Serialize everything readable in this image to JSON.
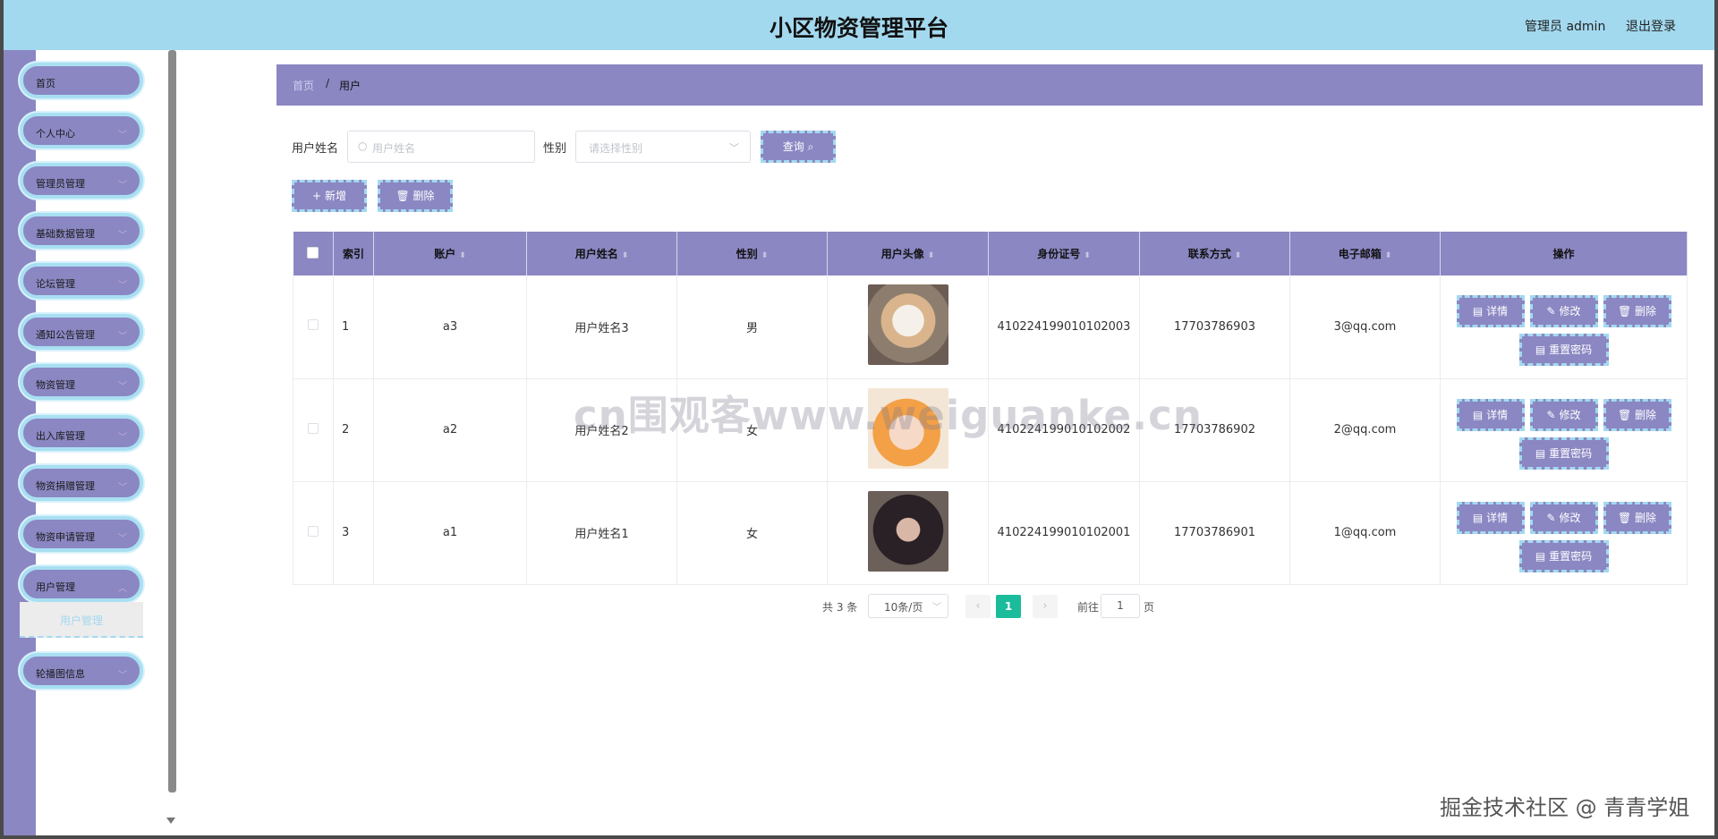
{
  "header": {
    "title": "小区物资管理平台",
    "admin": "管理员 admin",
    "logout": "退出登录"
  },
  "menu": [
    {
      "label": "首页",
      "chevron": false
    },
    {
      "label": "个人中心",
      "chevron": true
    },
    {
      "label": "管理员管理",
      "chevron": true
    },
    {
      "label": "基础数据管理",
      "chevron": true
    },
    {
      "label": "论坛管理",
      "chevron": true
    },
    {
      "label": "通知公告管理",
      "chevron": true
    },
    {
      "label": "物资管理",
      "chevron": true
    },
    {
      "label": "出入库管理",
      "chevron": true
    },
    {
      "label": "物资捐赠管理",
      "chevron": true
    },
    {
      "label": "物资申请管理",
      "chevron": true
    },
    {
      "label": "用户管理",
      "chevron": true
    },
    {
      "label": "轮播图信息",
      "chevron": true
    }
  ],
  "submenu": {
    "label": "用户管理"
  },
  "breadcrumb": {
    "home": "首页",
    "sep": "/",
    "current": "用户"
  },
  "search": {
    "name_label": "用户姓名",
    "name_placeholder": "用户姓名",
    "gender_label": "性别",
    "gender_placeholder": "请选择性别",
    "query": "查询"
  },
  "actions": {
    "add": "新增",
    "delete": "删除"
  },
  "table": {
    "columns": [
      "索引",
      "账户",
      "用户姓名",
      "性别",
      "用户头像",
      "身份证号",
      "联系方式",
      "电子邮箱",
      "操作"
    ],
    "rows": [
      {
        "index": "1",
        "account": "a3",
        "name": "用户姓名3",
        "gender": "男",
        "avatar": "shiba-dog-photo",
        "id": "410224199010102003",
        "phone": "17703786903",
        "email": "3@qq.com"
      },
      {
        "index": "2",
        "account": "a2",
        "name": "用户姓名2",
        "gender": "女",
        "avatar": "girl-photo",
        "id": "410224199010102002",
        "phone": "17703786902",
        "email": "2@qq.com"
      },
      {
        "index": "3",
        "account": "a1",
        "name": "用户姓名1",
        "gender": "女",
        "avatar": "boy-photo",
        "id": "410224199010102001",
        "phone": "17703786901",
        "email": "1@qq.com"
      }
    ],
    "row_actions": {
      "detail": "详情",
      "edit": "修改",
      "delete": "删除",
      "reset": "重置密码"
    }
  },
  "pagination": {
    "total": "共 3 条",
    "size": "10条/页",
    "current": "1",
    "goto": "前往",
    "goto_value": "1",
    "page": "页"
  },
  "watermark": "cn围观客www.weiguanke.cn",
  "signature": "掘金技术社区 @ 青青学姐",
  "colors": {
    "header": "#a3d9ef",
    "accent": "#8b87c3",
    "pager_active": "#1bbc9b"
  }
}
